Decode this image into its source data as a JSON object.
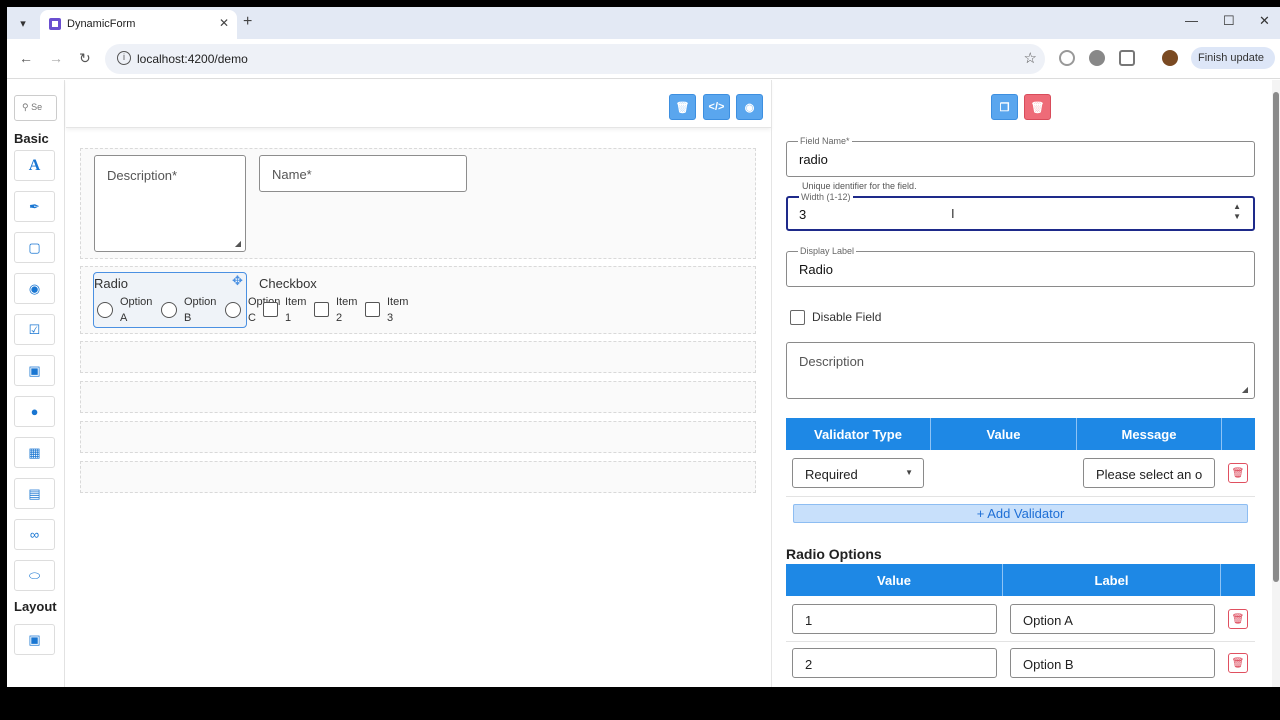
{
  "browser": {
    "tab_title": "DynamicForm",
    "url": "localhost:4200/demo",
    "finish_update": "Finish update"
  },
  "sidebar": {
    "search_placeholder": "Se",
    "basic_title": "Basic",
    "layout_title": "Layout"
  },
  "canvas": {
    "description_label": "Description*",
    "name_label": "Name*",
    "radio_group_label": "Radio",
    "radio_options": [
      "Option A",
      "Option B",
      "Option C"
    ],
    "checkbox_group_label": "Checkbox",
    "checkbox_items": [
      "Item 1",
      "Item 2",
      "Item 3"
    ]
  },
  "panel": {
    "field_name_label": "Field Name*",
    "field_name_value": "radio",
    "field_name_hint": "Unique identifier for the field.",
    "width_label": "Width (1-12)",
    "width_value": "3",
    "display_label_label": "Display Label",
    "display_label_value": "Radio",
    "disable_field": "Disable Field",
    "description_placeholder": "Description",
    "validators": {
      "headers": [
        "Validator Type",
        "Value",
        "Message"
      ],
      "rows": [
        {
          "type": "Required",
          "value": "",
          "message": "Please select an o"
        }
      ],
      "add_label": "+ Add Validator"
    },
    "radio_options_title": "Radio Options",
    "options_table": {
      "headers": [
        "Value",
        "Label"
      ],
      "rows": [
        {
          "value": "1",
          "label": "Option A"
        },
        {
          "value": "2",
          "label": "Option B"
        }
      ]
    }
  }
}
